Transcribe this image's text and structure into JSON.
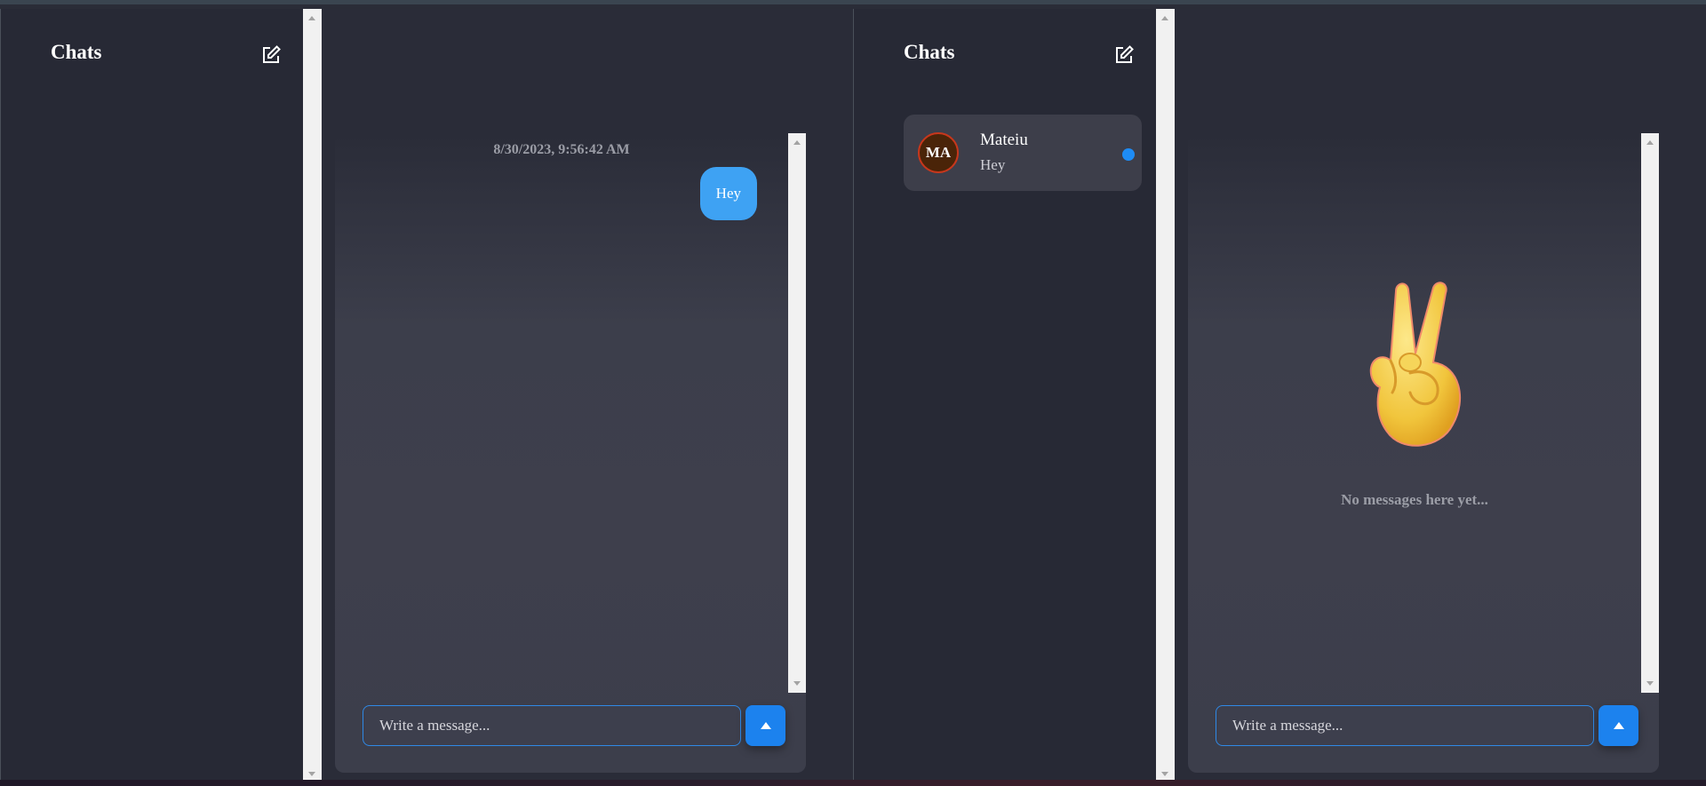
{
  "left_app": {
    "sidebar": {
      "title": "Chats",
      "compose_icon": "compose-icon"
    },
    "chat": {
      "timestamp": "8/30/2023, 9:56:42 AM",
      "messages": [
        {
          "text": "Hey",
          "from": "me"
        }
      ],
      "input_placeholder": "Write a message..."
    }
  },
  "right_app": {
    "sidebar": {
      "title": "Chats",
      "compose_icon": "compose-icon",
      "chats": [
        {
          "initials": "MA",
          "name": "Mateiu",
          "preview": "Hey",
          "unread": true
        }
      ]
    },
    "chat": {
      "empty_icon": "victory-hand-emoji",
      "empty_emoji": "✌️",
      "empty_text": "No messages here yet...",
      "input_placeholder": "Write a message..."
    }
  },
  "colors": {
    "accent": "#1e8cf5",
    "bubble": "#3ea2f3",
    "background": "#282a35",
    "avatar_bg": "#4a2408"
  }
}
